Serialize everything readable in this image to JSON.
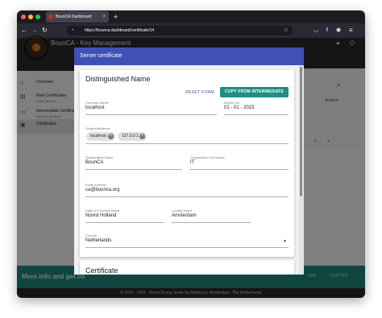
{
  "browser": {
    "tab_title": "BounCA Dashboard",
    "tab_close": "×",
    "new_tab": "+",
    "url": "https://bounca.dashboard/certificate/14",
    "nav_back": "←",
    "nav_forward": "→",
    "nav_reload": "↻",
    "star": "☆",
    "menu": "≡"
  },
  "app": {
    "title": "BounCA - Key Management"
  },
  "sidebar": {
    "items": [
      {
        "label": "Overview",
        "sub": ""
      },
      {
        "label": "Root Certificates",
        "sub": "BounCA Root"
      },
      {
        "label": "Intermediate Certificates",
        "sub": "BounCA Int Root"
      },
      {
        "label": "Certificates",
        "sub": ""
      }
    ]
  },
  "background": {
    "actions_header": "Actions",
    "pager_prev": "‹",
    "pager_next": "›",
    "promo_text": "More info and get co",
    "promo_link_1": "LAB",
    "promo_link_2": "TWITTER",
    "footer": "© 2016 - 2021 - BounCA.org, made by Repleo.nl, Amsterdam, The Netherlands"
  },
  "dialog": {
    "header": "Server certificate",
    "section_title": "Distinguished Name",
    "reset_label": "RESET FORM",
    "copy_label": "COPY FROM INTERMEDIATE",
    "fields": {
      "common_name": {
        "label": "Common Name*",
        "value": "localhost"
      },
      "expires_at": {
        "label": "Expires at*",
        "value": "01 - 01 - 2023"
      },
      "subject_alt_names": {
        "label": "SubjectAltNames",
        "chips": [
          "localhost",
          "127.0.0.1"
        ]
      },
      "organization": {
        "label": "Organization Name",
        "value": "BounCA"
      },
      "org_unit": {
        "label": "Organization Unit Name",
        "value": "IT"
      },
      "email": {
        "label": "Email Address",
        "value": "ca@bounca.org"
      },
      "state": {
        "label": "State or Province Name",
        "value": "Noord Holland"
      },
      "locality": {
        "label": "Locality Name",
        "value": "Amsterdam"
      },
      "country": {
        "label": "Country",
        "value": "Netherlands"
      }
    },
    "cert_section_title": "Certificate",
    "scrollbar_position": 0.0
  }
}
